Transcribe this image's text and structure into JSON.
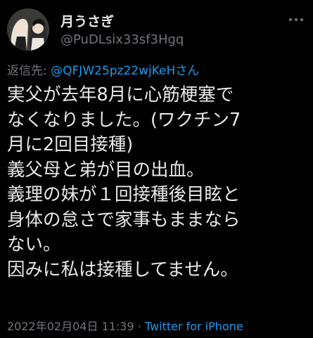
{
  "user": {
    "display_name": "月うさぎ",
    "handle": "@PuDLsix33sf3Hgq",
    "avatar_icon": "avatar-illustration-two-figures"
  },
  "reply": {
    "prefix": "返信先: ",
    "mention": "@QFJW25pz22wjKeHさん"
  },
  "tweet": {
    "lines": [
      "実父が去年8月に心筋梗塞で",
      "なくなりました。(ワクチン7",
      "月に2回目接種)",
      "義父母と弟が目の出血。",
      "義理の妹が１回接種後目眩と",
      "身体の怠さで家事もままなら",
      "ない。",
      "因みに私は接種してません。"
    ]
  },
  "meta": {
    "timestamp": "2022年02月04日 11:39",
    "separator": " · ",
    "source": "Twitter for iPhone"
  },
  "colors": {
    "background": "#000000",
    "text": "#e7e9ea",
    "secondary": "#71767b",
    "link": "#1d9bf0"
  }
}
